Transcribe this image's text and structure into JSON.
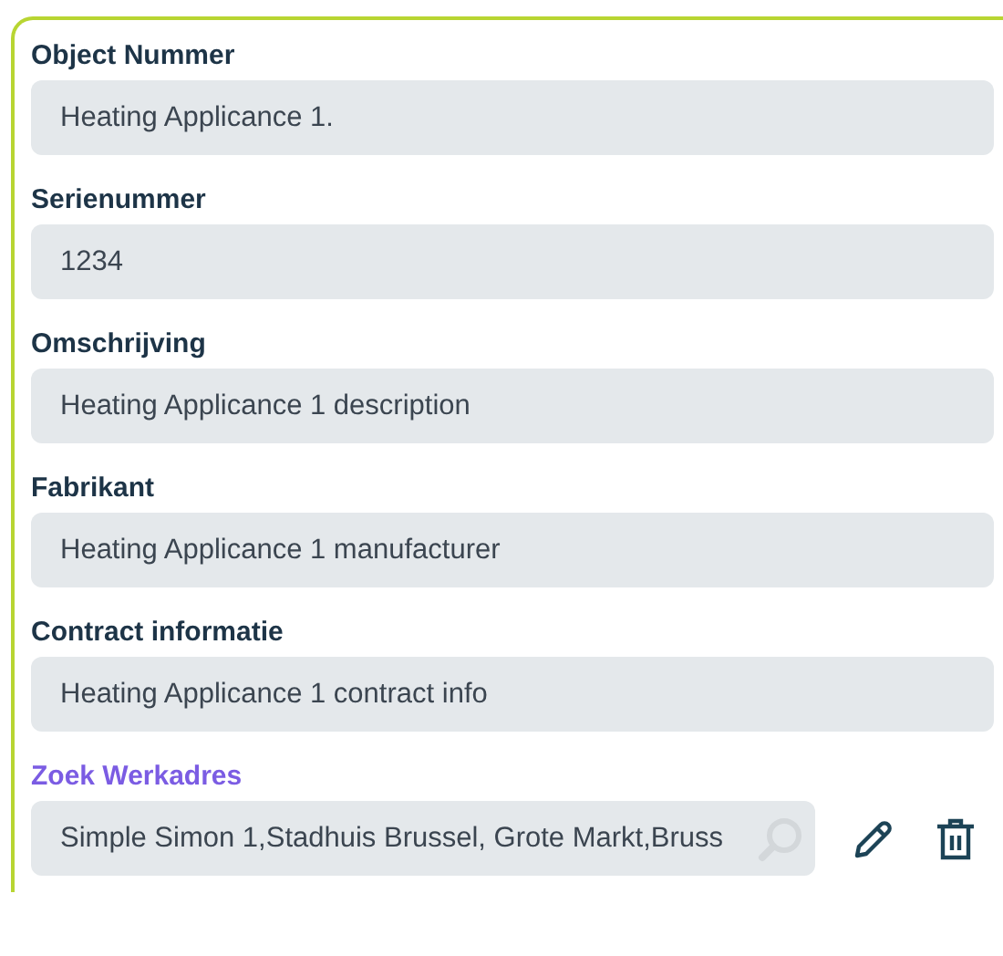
{
  "fields": [
    {
      "kind": "text",
      "label": "Object Nummer",
      "value": "Heating Applicance 1."
    },
    {
      "kind": "text",
      "label": "Serienummer",
      "value": "1234"
    },
    {
      "kind": "text",
      "label": "Omschrijving",
      "value": "Heating Applicance 1 description"
    },
    {
      "kind": "text",
      "label": "Fabrikant",
      "value": "Heating Applicance 1 manufacturer"
    },
    {
      "kind": "text",
      "label": "Contract informatie",
      "value": "Heating Applicance 1 contract info"
    },
    {
      "kind": "search",
      "label": "Zoek Werkadres",
      "value": "Simple Simon 1,Stadhuis Brussel, Grote Markt,Bruss"
    }
  ]
}
